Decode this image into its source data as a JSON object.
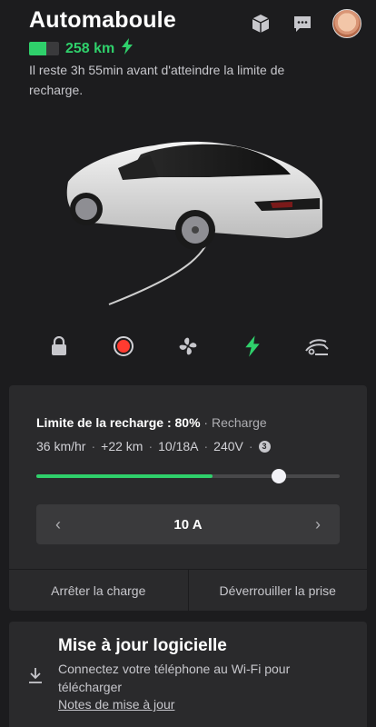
{
  "vehicle": {
    "name": "Automaboule",
    "range": "258 km",
    "battery_level": 0.58,
    "status_text": "Il reste 3h 55min avant d'atteindre la limite de recharge."
  },
  "header": {
    "icons": [
      "box-icon",
      "chat-icon",
      "avatar"
    ]
  },
  "controls": [
    {
      "name": "lock-icon",
      "color": "#c7c7cc"
    },
    {
      "name": "record-icon",
      "color": "#ff3b30"
    },
    {
      "name": "fan-icon",
      "color": "#c7c7cc"
    },
    {
      "name": "charge-bolt-icon",
      "color": "#2fd06b"
    },
    {
      "name": "trunk-icon",
      "color": "#c7c7cc"
    }
  ],
  "charging": {
    "limit_label": "Limite de la recharge : 80%",
    "state_label": "Recharge",
    "separator": "·",
    "stats": [
      "36 km/hr",
      "+22 km",
      "10/18A",
      "240V"
    ],
    "info_badge": "3",
    "limit_value": 0.8,
    "current_level": 0.58,
    "current_amps": "10 A",
    "stop_label": "Arrêter la charge",
    "unlock_label": "Déverrouiller la prise"
  },
  "update": {
    "title": "Mise à jour logicielle",
    "description": "Connectez votre téléphone au Wi-Fi pour télécharger",
    "link": "Notes de mise à jour"
  },
  "colors": {
    "accent": "#2fd06b",
    "background": "#1c1c1e",
    "card": "#2a2a2c",
    "alert": "#ff3b30"
  }
}
